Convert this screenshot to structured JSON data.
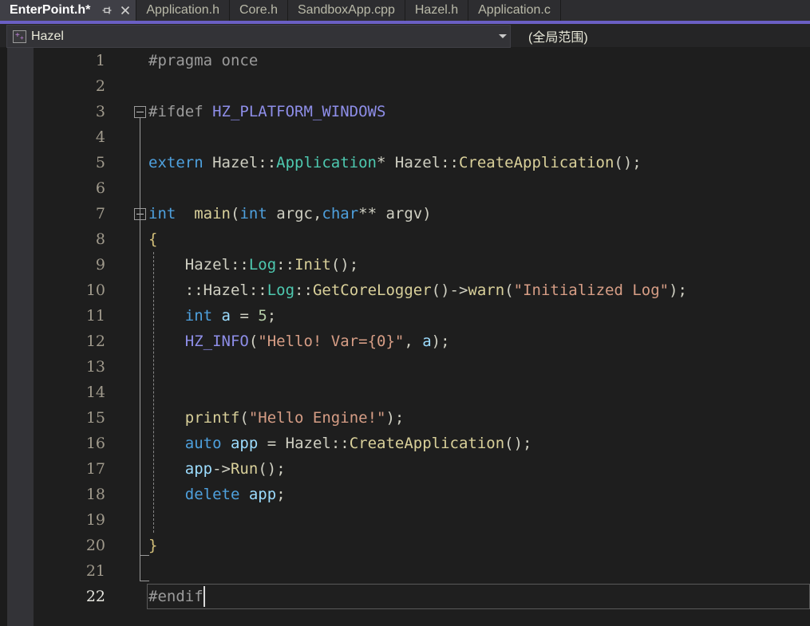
{
  "window": {
    "accent_color": "#6a5fc4",
    "editor_bg": "#1e1e1e",
    "chrome_bg": "#2d2d30"
  },
  "tabs": [
    {
      "label": "EnterPoint.h*",
      "active": true,
      "pin_icon": "pin-icon",
      "close_icon": "close-icon"
    },
    {
      "label": "Application.h",
      "active": false
    },
    {
      "label": "Core.h",
      "active": false
    },
    {
      "label": "SandboxApp.cpp",
      "active": false
    },
    {
      "label": "Hazel.h",
      "active": false
    },
    {
      "label": "Application.c",
      "active": false
    }
  ],
  "navbar": {
    "project_icon": "cpp-file-icon",
    "project": "Hazel",
    "dropdown_caret": "chevron-down-icon",
    "scope": "(全局范围)"
  },
  "editor": {
    "current_line": 22,
    "lines": [
      {
        "n": 1,
        "tokens": [
          {
            "t": "#pragma once",
            "c": "t-pp"
          }
        ]
      },
      {
        "n": 2,
        "tokens": []
      },
      {
        "n": 3,
        "fold": "collapse",
        "tokens": [
          {
            "t": "#ifdef ",
            "c": "t-pp"
          },
          {
            "t": "HZ_PLATFORM_WINDOWS",
            "c": "t-macro"
          }
        ]
      },
      {
        "n": 4,
        "tokens": []
      },
      {
        "n": 5,
        "indent": 1,
        "tokens": [
          {
            "t": "extern",
            "c": "t-kw"
          },
          {
            "t": " Hazel::",
            "c": "t-plain"
          },
          {
            "t": "Application",
            "c": "t-type"
          },
          {
            "t": "* Hazel::",
            "c": "t-plain"
          },
          {
            "t": "CreateApplication",
            "c": "t-fn"
          },
          {
            "t": "();",
            "c": "t-punct"
          }
        ]
      },
      {
        "n": 6,
        "tokens": []
      },
      {
        "n": 7,
        "fold": "collapse",
        "tokens": [
          {
            "t": "int",
            "c": "t-kw"
          },
          {
            "t": "  ",
            "c": "t-plain"
          },
          {
            "t": "main",
            "c": "t-fn"
          },
          {
            "t": "(",
            "c": "t-punct"
          },
          {
            "t": "int",
            "c": "t-kw"
          },
          {
            "t": " argc,",
            "c": "t-plain"
          },
          {
            "t": "char",
            "c": "t-kw"
          },
          {
            "t": "** argv)",
            "c": "t-plain"
          }
        ]
      },
      {
        "n": 8,
        "indent": 1,
        "tokens": [
          {
            "t": "{",
            "c": "t-brace"
          }
        ]
      },
      {
        "n": 9,
        "indent": 1,
        "tokens": [
          {
            "t": "    Hazel::",
            "c": "t-plain"
          },
          {
            "t": "Log",
            "c": "t-type"
          },
          {
            "t": "::",
            "c": "t-plain"
          },
          {
            "t": "Init",
            "c": "t-fn"
          },
          {
            "t": "();",
            "c": "t-punct"
          }
        ]
      },
      {
        "n": 10,
        "indent": 1,
        "tokens": [
          {
            "t": "    ::Hazel::",
            "c": "t-plain"
          },
          {
            "t": "Log",
            "c": "t-type"
          },
          {
            "t": "::",
            "c": "t-plain"
          },
          {
            "t": "GetCoreLogger",
            "c": "t-fn"
          },
          {
            "t": "()->",
            "c": "t-punct"
          },
          {
            "t": "warn",
            "c": "t-fn"
          },
          {
            "t": "(",
            "c": "t-punct"
          },
          {
            "t": "\"Initialized Log\"",
            "c": "t-str"
          },
          {
            "t": ");",
            "c": "t-punct"
          }
        ]
      },
      {
        "n": 11,
        "indent": 1,
        "tokens": [
          {
            "t": "    ",
            "c": "t-plain"
          },
          {
            "t": "int",
            "c": "t-kw"
          },
          {
            "t": " ",
            "c": "t-plain"
          },
          {
            "t": "a",
            "c": "t-var"
          },
          {
            "t": " = ",
            "c": "t-plain"
          },
          {
            "t": "5",
            "c": "t-num"
          },
          {
            "t": ";",
            "c": "t-punct"
          }
        ]
      },
      {
        "n": 12,
        "indent": 1,
        "tokens": [
          {
            "t": "    ",
            "c": "t-plain"
          },
          {
            "t": "HZ_INFO",
            "c": "t-macro"
          },
          {
            "t": "(",
            "c": "t-punct"
          },
          {
            "t": "\"Hello! Var={0}\"",
            "c": "t-str"
          },
          {
            "t": ", ",
            "c": "t-plain"
          },
          {
            "t": "a",
            "c": "t-var"
          },
          {
            "t": ");",
            "c": "t-punct"
          }
        ]
      },
      {
        "n": 13,
        "indent": 1,
        "tokens": []
      },
      {
        "n": 14,
        "indent": 1,
        "tokens": []
      },
      {
        "n": 15,
        "indent": 1,
        "tokens": [
          {
            "t": "    ",
            "c": "t-plain"
          },
          {
            "t": "printf",
            "c": "t-fn"
          },
          {
            "t": "(",
            "c": "t-punct"
          },
          {
            "t": "\"Hello Engine!\"",
            "c": "t-str"
          },
          {
            "t": ");",
            "c": "t-punct"
          }
        ]
      },
      {
        "n": 16,
        "indent": 1,
        "tokens": [
          {
            "t": "    ",
            "c": "t-plain"
          },
          {
            "t": "auto",
            "c": "t-kw"
          },
          {
            "t": " ",
            "c": "t-plain"
          },
          {
            "t": "app",
            "c": "t-var"
          },
          {
            "t": " = Hazel::",
            "c": "t-plain"
          },
          {
            "t": "CreateApplication",
            "c": "t-fn"
          },
          {
            "t": "();",
            "c": "t-punct"
          }
        ]
      },
      {
        "n": 17,
        "indent": 1,
        "tokens": [
          {
            "t": "    ",
            "c": "t-plain"
          },
          {
            "t": "app",
            "c": "t-var"
          },
          {
            "t": "->",
            "c": "t-punct"
          },
          {
            "t": "Run",
            "c": "t-fn"
          },
          {
            "t": "();",
            "c": "t-punct"
          }
        ]
      },
      {
        "n": 18,
        "indent": 1,
        "tokens": [
          {
            "t": "    ",
            "c": "t-plain"
          },
          {
            "t": "delete",
            "c": "t-kw"
          },
          {
            "t": " ",
            "c": "t-plain"
          },
          {
            "t": "app",
            "c": "t-var"
          },
          {
            "t": ";",
            "c": "t-punct"
          }
        ]
      },
      {
        "n": 19,
        "indent": 1,
        "tokens": []
      },
      {
        "n": 20,
        "indent": 1,
        "tokens": [
          {
            "t": "}",
            "c": "t-brace"
          }
        ]
      },
      {
        "n": 21,
        "tokens": []
      },
      {
        "n": 22,
        "current": true,
        "tokens": [
          {
            "t": "#endif",
            "c": "t-pp"
          }
        ]
      }
    ]
  }
}
